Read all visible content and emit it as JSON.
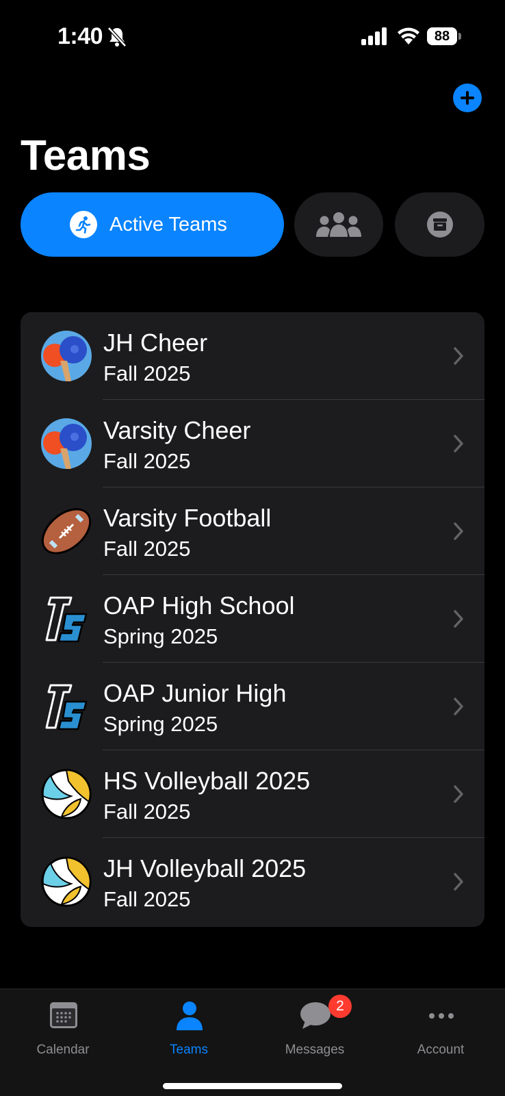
{
  "status_bar": {
    "time": "1:40",
    "battery": "88"
  },
  "header": {
    "title": "Teams"
  },
  "filters": {
    "active_label": "Active Teams"
  },
  "teams": [
    {
      "name": "JH Cheer",
      "season": "Fall 2025",
      "icon": "cheer-pompom-icon"
    },
    {
      "name": "Varsity Cheer",
      "season": "Fall 2025",
      "icon": "cheer-pompom-icon"
    },
    {
      "name": "Varsity Football",
      "season": "Fall 2025",
      "icon": "football-icon"
    },
    {
      "name": "OAP High School",
      "season": "Spring 2025",
      "icon": "ts-logo-icon"
    },
    {
      "name": "OAP Junior High",
      "season": "Spring 2025",
      "icon": "ts-logo-icon"
    },
    {
      "name": "HS Volleyball 2025",
      "season": "Fall 2025",
      "icon": "volleyball-icon"
    },
    {
      "name": "JH Volleyball 2025",
      "season": "Fall 2025",
      "icon": "volleyball-icon"
    }
  ],
  "tabbar": {
    "calendar": "Calendar",
    "teams": "Teams",
    "messages": "Messages",
    "messages_badge": "2",
    "account": "Account"
  },
  "colors": {
    "accent": "#0a84ff",
    "badge": "#ff3b30",
    "card": "#1c1c1e"
  }
}
